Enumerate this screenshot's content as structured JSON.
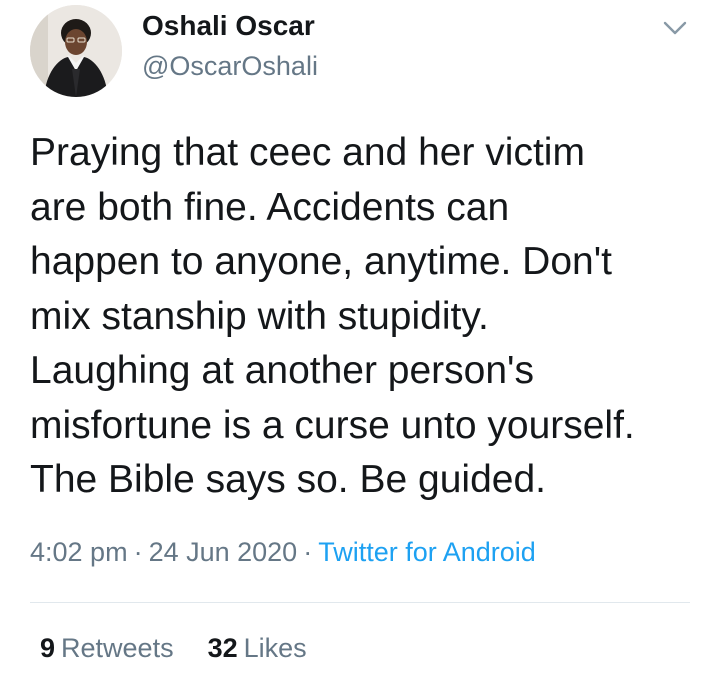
{
  "author": {
    "display_name": "Oshali Oscar",
    "handle": "@OscarOshali",
    "avatar_icon": "profile-photo"
  },
  "menu_icon": "chevron-down-icon",
  "tweet": {
    "text": "Praying that ceec and her victim\nare both fine. Accidents can\nhappen to anyone, anytime. Don't\nmix stanship with stupidity.\nLaughing at another person's\nmisfortune is a curse unto yourself.\nThe Bible says so. Be guided.",
    "time": "4:02 pm",
    "separator": "·",
    "date": "24 Jun 2020",
    "source": "Twitter for Android"
  },
  "stats": {
    "retweets_count": "9",
    "retweets_label": "Retweets",
    "likes_count": "32",
    "likes_label": "Likes"
  },
  "colors": {
    "text_primary": "#14171a",
    "text_secondary": "#657786",
    "link": "#1da1f2",
    "divider": "#e1e8ed"
  }
}
